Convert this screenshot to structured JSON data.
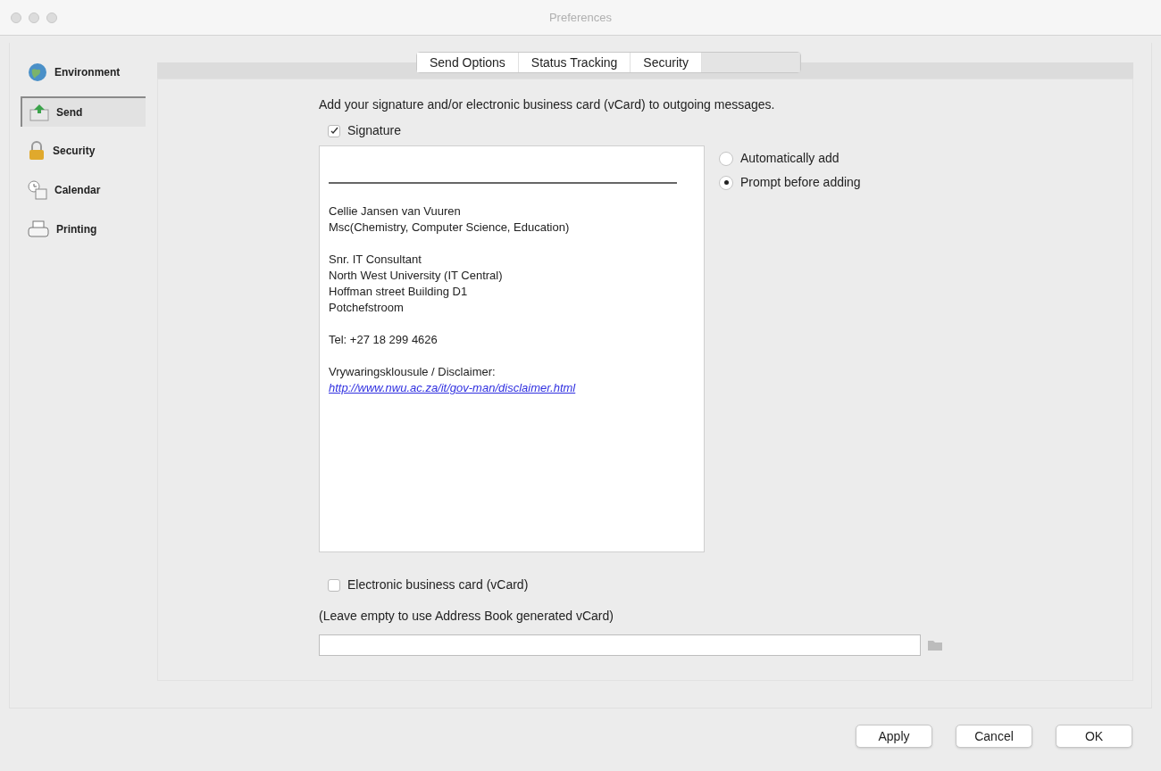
{
  "window": {
    "title": "Preferences"
  },
  "sidebar": {
    "items": [
      {
        "label": "Environment",
        "kind": "globe",
        "selected": false
      },
      {
        "label": "Send",
        "kind": "send",
        "selected": true
      },
      {
        "label": "Security",
        "kind": "lock",
        "selected": false
      },
      {
        "label": "Calendar",
        "kind": "calendar",
        "selected": false
      },
      {
        "label": "Printing",
        "kind": "printer",
        "selected": false
      }
    ]
  },
  "tabs": [
    {
      "label": "Send Options",
      "selected": false
    },
    {
      "label": "Status Tracking",
      "selected": false
    },
    {
      "label": "Security",
      "selected": false
    },
    {
      "selected": true
    }
  ],
  "intro": "Add your signature and/or electronic business card (vCard) to outgoing messages.",
  "signature": {
    "label": "Signature",
    "checked": true,
    "paragraphs": [
      [
        "Cellie Jansen van Vuuren",
        "Msc(Chemistry, Computer Science, Education)"
      ],
      [
        "Snr. IT Consultant",
        "North West University (IT Central)",
        "Hoffman street Building D1",
        "Potchefstroom"
      ],
      [
        "Tel: +27 18 299 4626"
      ],
      [
        "Vrywaringsklousule / Disclaimer:"
      ]
    ],
    "link": "http://www.nwu.ac.za/it/gov-man/disclaimer.html"
  },
  "radios": [
    {
      "label": "Automatically add",
      "selected": false
    },
    {
      "label": "Prompt before adding",
      "selected": true
    }
  ],
  "vcard": {
    "label": "Electronic business card (vCard)",
    "checked": false,
    "hint": "(Leave empty to use Address Book generated vCard)"
  },
  "buttons": [
    "Apply",
    "Cancel",
    "OK"
  ]
}
